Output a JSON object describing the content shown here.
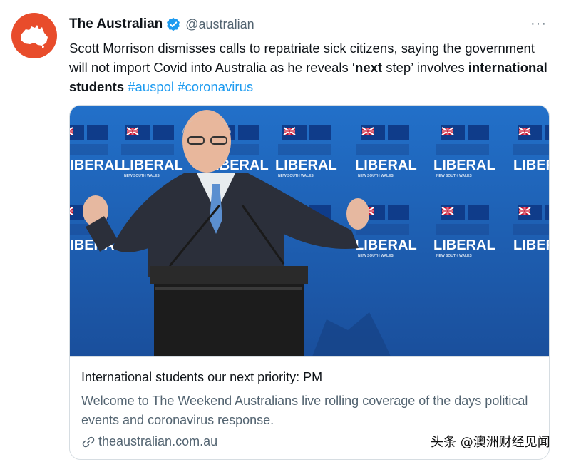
{
  "account": {
    "name": "The Australian",
    "handle": "@australian",
    "avatar_color": "#e84c2b"
  },
  "more_label": "···",
  "tweet": {
    "segments": {
      "t1": "Scott Morrison dismisses calls to repatriate sick citizens, saying the government will not import Covid into Australia as he reveals ‘",
      "b1": "next",
      "t2": " step’ involves ",
      "b2": "international students",
      "h1": "#auspol",
      "h2": "#coronavirus"
    }
  },
  "card": {
    "image_alt": "Scott Morrison at a podium in front of a Liberal New South Wales backdrop",
    "backdrop_text": "LIBERAL",
    "backdrop_subtext": "NEW SOUTH WALES",
    "title": "International students our next priority: PM",
    "description": "Welcome to The Weekend Australians live rolling coverage of the days political events and coronavirus response.",
    "domain": "theaustralian.com.au"
  },
  "watermark": "头条 @澳洲财经见闻",
  "colors": {
    "link": "#1d9bf0",
    "secondary_text": "#536471",
    "backdrop_blue": "#1f63b8"
  }
}
